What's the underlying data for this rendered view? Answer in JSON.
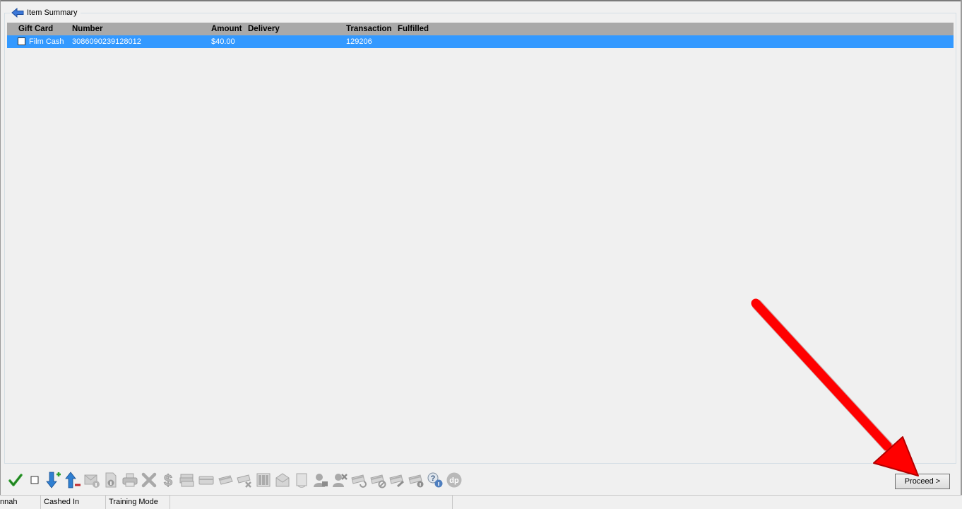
{
  "group": {
    "title": "Item Summary",
    "icon": "back-arrow-icon"
  },
  "grid": {
    "columns": [
      "Gift Card",
      "Number",
      "Amount",
      "Delivery",
      "Transaction",
      "Fulfilled"
    ],
    "rows": [
      {
        "checked": false,
        "gift_card": "Film Cash",
        "number": "3086090239128012",
        "amount": "$40.00",
        "delivery": "",
        "transaction": "129206",
        "fulfilled": ""
      }
    ],
    "selected_row_color": "#3399ff",
    "header_color": "#a9a9a9"
  },
  "toolbar": {
    "icons": [
      "check-all-icon",
      "uncheck-all-icon",
      "move-down-add-icon",
      "move-up-remove-icon",
      "mail-info-icon",
      "document-info-icon",
      "print-icon",
      "delete-icon",
      "dollar-icon",
      "cash-stack-icon",
      "card-icon",
      "card-swipe-icon",
      "card-remove-icon",
      "barcode-icon",
      "envelope-icon",
      "receipt-icon",
      "user-lock-icon",
      "user-remove-icon",
      "card-refresh-icon",
      "card-cancel-icon",
      "card-edit-icon",
      "card-info-icon",
      "help-info-icon",
      "dp-logo-icon"
    ]
  },
  "proceed_button": {
    "label": "Proceed >"
  },
  "annotation": {
    "color": "#ff0000"
  },
  "status_bar": {
    "user": "nnah",
    "cash_status": "Cashed In",
    "mode": "Training Mode"
  }
}
